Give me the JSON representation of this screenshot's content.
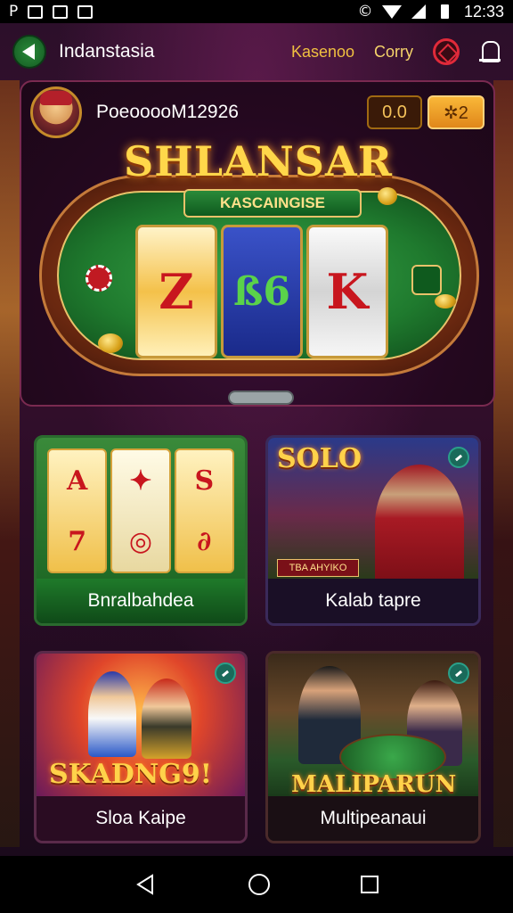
{
  "status_bar": {
    "left_text": "P",
    "time": "12:33"
  },
  "header": {
    "title": "Indanstasia",
    "links": [
      "Kasenoo",
      "Corry"
    ]
  },
  "player": {
    "username": "PoeooooM12926",
    "score": "0.0",
    "coins": "✲2"
  },
  "hero": {
    "title": "SHLANSAR",
    "subtitle": "KASCAINGISE",
    "reels": [
      "Z",
      "ß6",
      "K"
    ]
  },
  "cards": [
    {
      "label": "Bnralbahdea",
      "reel_symbols": [
        [
          "A",
          "7"
        ],
        [
          "✦",
          "◎"
        ],
        [
          "S",
          "∂"
        ]
      ]
    },
    {
      "label": "Kalab tapre",
      "art_title": "SOLO",
      "banner": "TBA AHYIKO"
    },
    {
      "label": "Sloa Kaipe",
      "art_title": "SKADNG9!"
    },
    {
      "label": "Multipeanaui",
      "art_title": "MALIPARUN"
    }
  ],
  "icons": {
    "back": "back-arrow-icon",
    "target": "target-icon",
    "bell": "bell-icon"
  },
  "colors": {
    "accent_gold": "#f0c040",
    "felt_green": "#1f7a2e",
    "brand_red": "#e02a3a"
  }
}
